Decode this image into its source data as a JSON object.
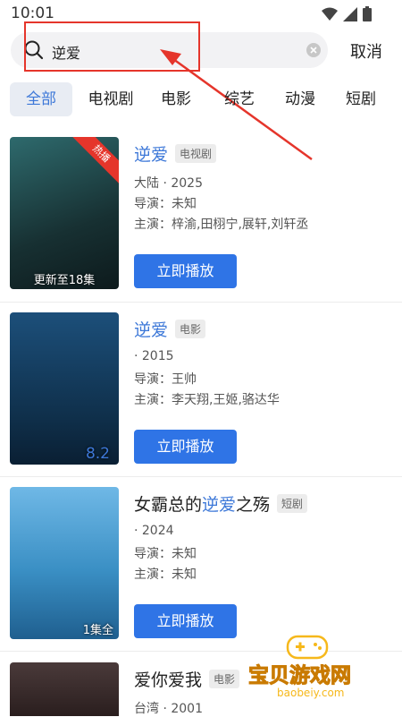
{
  "status_bar": {
    "time": "10:01"
  },
  "search": {
    "query": "逆爱",
    "cancel_label": "取消"
  },
  "tabs": [
    {
      "label": "全部",
      "active": true
    },
    {
      "label": "电视剧"
    },
    {
      "label": "电影"
    },
    {
      "label": "综艺"
    },
    {
      "label": "动漫"
    },
    {
      "label": "短剧"
    }
  ],
  "results": [
    {
      "title_parts": [
        "",
        "逆爱",
        ""
      ],
      "type": "电视剧",
      "line1": "大陆 · 2025",
      "director": "导演：未知",
      "cast": "主演：梓渝,田栩宁,展轩,刘轩丞",
      "play_label": "立即播放",
      "hot_badge": "热播",
      "poster_caption": "更新至18集",
      "poster_color": "#1d3b3f"
    },
    {
      "title_parts": [
        "",
        "逆爱",
        ""
      ],
      "type": "电影",
      "line1": "· 2015",
      "director": "导演：王帅",
      "cast": "主演：李天翔,王姬,骆达华",
      "play_label": "立即播放",
      "poster_caption": "8.2",
      "poster_color": "#1d4d73"
    },
    {
      "title_parts": [
        "女霸总的",
        "逆爱",
        "之殇"
      ],
      "type": "短剧",
      "line1": "· 2024",
      "director": "导演：未知",
      "cast": "主演：未知",
      "play_label": "立即播放",
      "poster_caption": "1集全",
      "poster_color": "#3a8fc4"
    },
    {
      "title_parts": [
        "爱你爱我",
        "",
        ""
      ],
      "type": "电影",
      "line1": "台湾 · 2001",
      "poster_color": "#3b2c2c"
    }
  ],
  "watermark": {
    "text": "宝贝游戏网",
    "url": "baobeiy.com"
  },
  "colors": {
    "accent": "#3d78d8",
    "button": "#2f74e6",
    "annotation": "#e5352b",
    "watermark": "#f6b81b"
  },
  "icons": [
    "signal-icon",
    "wifi-icon",
    "battery-icon",
    "search-icon",
    "clear-icon"
  ]
}
